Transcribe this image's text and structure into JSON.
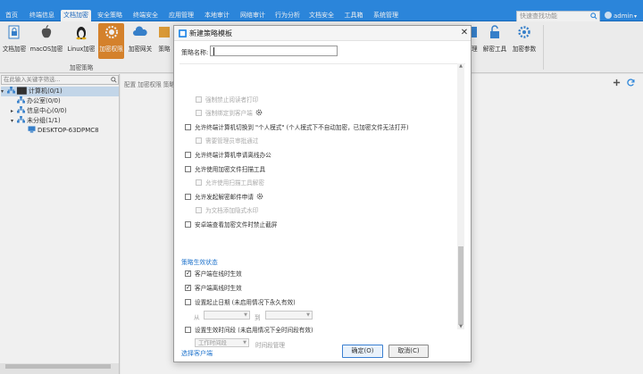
{
  "nav": {
    "tabs": [
      {
        "label": "首页"
      },
      {
        "label": "终端信息"
      },
      {
        "label": "文档加密"
      },
      {
        "label": "安全策略"
      },
      {
        "label": "终端安全"
      },
      {
        "label": "应用管理"
      },
      {
        "label": "本地审计"
      },
      {
        "label": "网络审计"
      },
      {
        "label": "行为分析"
      },
      {
        "label": "文档安全"
      },
      {
        "label": "工具箱"
      },
      {
        "label": "系统管理"
      }
    ],
    "active_tab": "文档加密",
    "search_placeholder": "快速查找功能",
    "user": "admin"
  },
  "ribbon": {
    "buttons": [
      {
        "label": "文档加密",
        "icon": "document-lock-icon"
      },
      {
        "label": "macOS加密",
        "icon": "apple-icon"
      },
      {
        "label": "Linux加密",
        "icon": "linux-icon"
      },
      {
        "label": "加密权限",
        "icon": "shield-gear-icon",
        "selected": true
      },
      {
        "label": "加密网关",
        "icon": "cloud-icon"
      },
      {
        "label": "策略",
        "icon": "policy-icon"
      }
    ],
    "right_buttons": [
      {
        "label": "管理",
        "icon": "manage-icon"
      },
      {
        "label": "解密工具",
        "icon": "unlock-icon"
      },
      {
        "label": "加密参数",
        "icon": "gear-icon"
      }
    ],
    "group_label": "加密策略"
  },
  "left_panel": {
    "search_placeholder": "在此输入关键字筛选...",
    "tree": [
      {
        "label": "██ 计算机(0/1)",
        "level": 0,
        "expand": "▾"
      },
      {
        "label": "办公室(0/0)",
        "level": 1,
        "expand": ""
      },
      {
        "label": "信息中心(0/0)",
        "level": 1,
        "expand": "▸"
      },
      {
        "label": "未分组(1/1)",
        "level": 1,
        "expand": "▾"
      },
      {
        "label": "DESKTOP-63DPMC8",
        "level": 2,
        "expand": ""
      }
    ]
  },
  "content": {
    "breadcrumb": "配置 加密权限 策略"
  },
  "modal": {
    "title": "新建策略模板",
    "name_label": "策略名称:",
    "name_value": "",
    "options": [
      {
        "label": "强制禁止阅读者打印",
        "checked": false,
        "disabled": true,
        "indent": 1,
        "gear": false
      },
      {
        "label": "强制绑定到客户端",
        "checked": false,
        "disabled": true,
        "indent": 1,
        "gear": true
      },
      {
        "label": "允许终端计算机切换到 \"个人模式\" (个人模式下不自动加密，已加密文件无法打开)",
        "checked": false,
        "disabled": false,
        "indent": 0,
        "gear": false
      },
      {
        "label": "需要管理员审批通过",
        "checked": false,
        "disabled": true,
        "indent": 1,
        "gear": false
      },
      {
        "label": "允许终端计算机申请离线办公",
        "checked": false,
        "disabled": false,
        "indent": 0,
        "gear": false
      },
      {
        "label": "允许使用加密文件扫描工具",
        "checked": false,
        "disabled": false,
        "indent": 0,
        "gear": false
      },
      {
        "label": "允许使用扫描工具解密",
        "checked": false,
        "disabled": true,
        "indent": 1,
        "gear": false
      },
      {
        "label": "允许发起解密邮件申请",
        "checked": false,
        "disabled": false,
        "indent": 0,
        "gear": true
      },
      {
        "label": "为文档添加隐式水印",
        "checked": false,
        "disabled": true,
        "indent": 1,
        "gear": false
      },
      {
        "label": "安卓端查看加密文件时禁止截屏",
        "checked": false,
        "disabled": false,
        "indent": 0,
        "gear": false
      }
    ],
    "section_title": "策略生效状态",
    "status_options": [
      {
        "label": "客户端在线时生效",
        "checked": true
      },
      {
        "label": "客户端离线时生效",
        "checked": true
      },
      {
        "label": "设置起止日期 (未启用情况下永久有效)",
        "checked": false
      },
      {
        "label": "设置生效时间段 (未启用情况下全时间段有效)",
        "checked": false
      }
    ],
    "date_from_label": "从",
    "date_to_label": "到",
    "time_select": "工作时间段",
    "time_link": "时间段管理",
    "footer_link": "选择客户端",
    "ok_label": "确定(O)",
    "cancel_label": "取消(C)"
  },
  "colors": {
    "nav_bg": "#2e8ee8",
    "accent": "#1f73cc",
    "selected_ribbon": "#e28a2e"
  }
}
